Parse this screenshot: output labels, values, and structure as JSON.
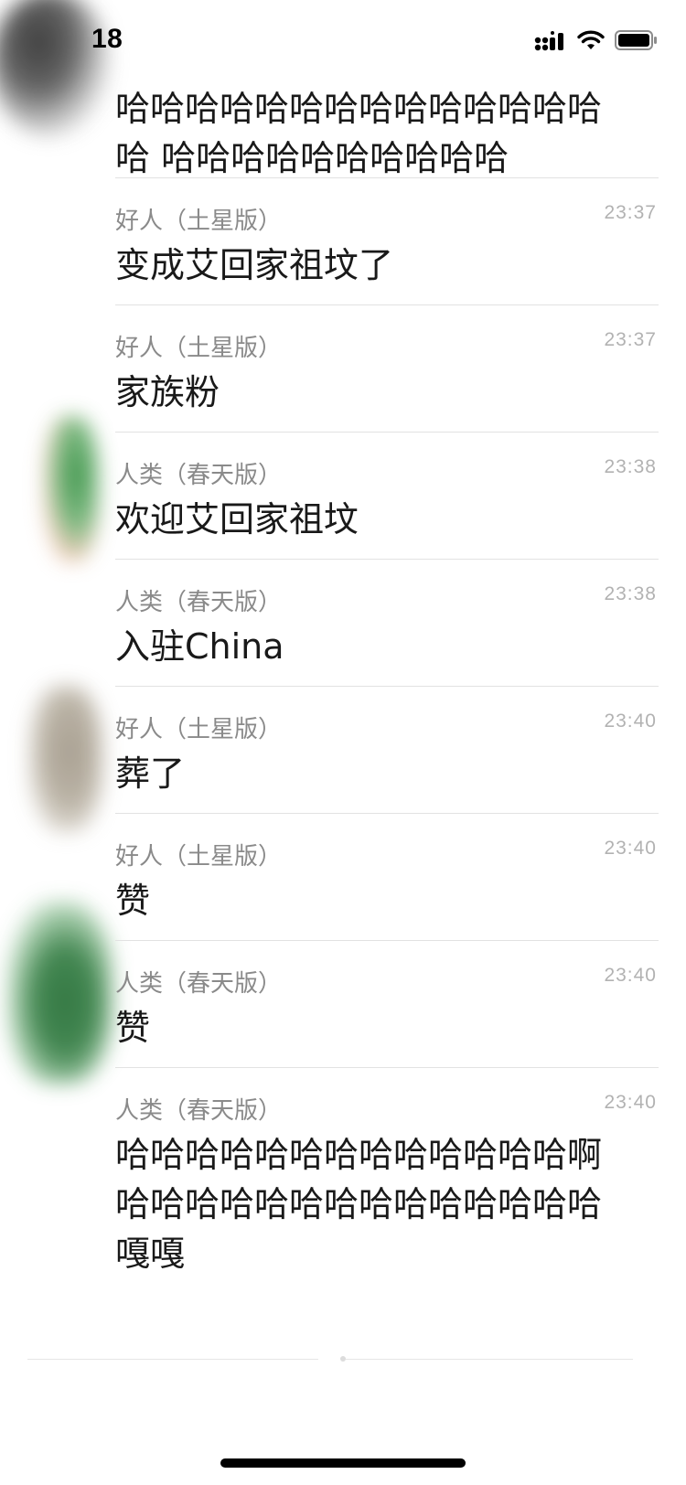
{
  "status_bar": {
    "time": "18",
    "icons": [
      "cellular-signal-icon",
      "wifi-icon",
      "battery-icon"
    ]
  },
  "messages": [
    {
      "sender": "",
      "time": "",
      "content": "哈哈哈哈哈哈哈哈哈哈哈哈哈哈哈 哈哈哈哈哈哈哈哈哈哈",
      "cut_off_top": true
    },
    {
      "sender": "好人（土星版）",
      "time": "23:37",
      "content": "变成艾回家祖坟了"
    },
    {
      "sender": "好人（土星版）",
      "time": "23:37",
      "content": "家族粉"
    },
    {
      "sender": "人类（春天版）",
      "time": "23:38",
      "content": "欢迎艾回家祖坟"
    },
    {
      "sender": "人类（春天版）",
      "time": "23:38",
      "content": "入驻China"
    },
    {
      "sender": "好人（土星版）",
      "time": "23:40",
      "content": "葬了"
    },
    {
      "sender": "好人（土星版）",
      "time": "23:40",
      "content": "赞"
    },
    {
      "sender": "人类（春天版）",
      "time": "23:40",
      "content": "赞"
    },
    {
      "sender": "人类（春天版）",
      "time": "23:40",
      "content": "哈哈哈哈哈哈哈哈哈哈哈哈哈啊哈哈哈哈哈哈哈哈哈哈哈哈哈哈嘎嘎"
    }
  ],
  "colors": {
    "sender": "#8a8a8a",
    "time": "#b2b2b2",
    "content": "#191919",
    "divider": "#e2e2e2"
  }
}
